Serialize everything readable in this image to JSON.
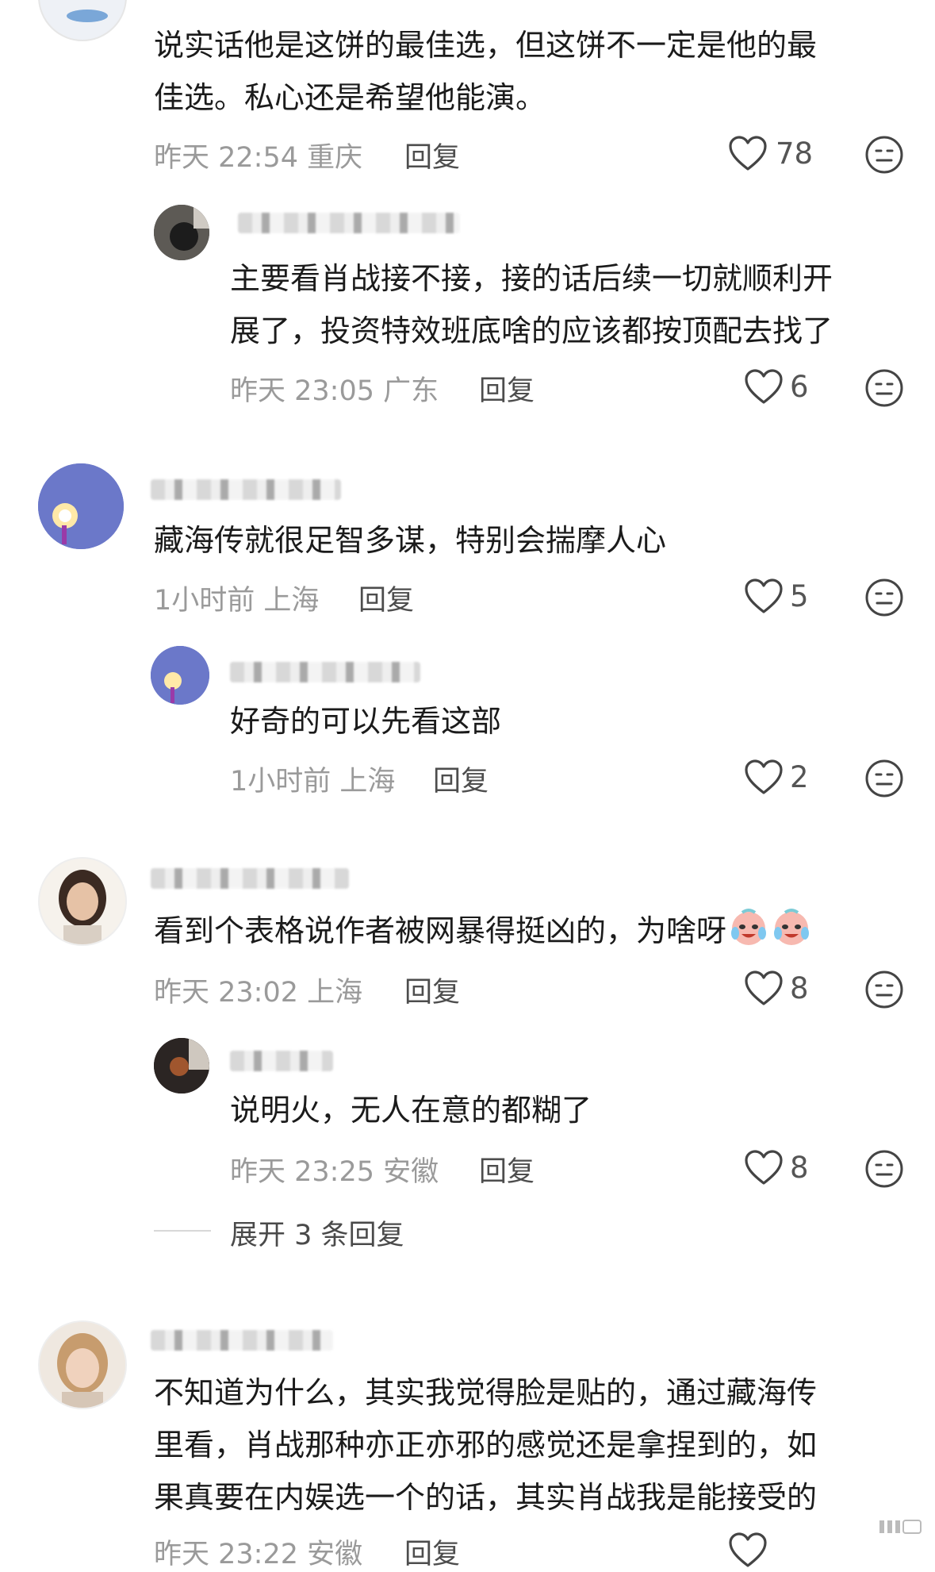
{
  "comments": [
    {
      "lines": [
        "说实话他是这饼的最佳选，但这饼不一定是他的最",
        "佳选。私心还是希望他能演。"
      ],
      "time": "昨天 22:54 重庆",
      "reply": "回复",
      "likes": "78"
    },
    {
      "lines": [
        "主要看肖战接不接，接的话后续一切就顺利开",
        "展了，投资特效班底啥的应该都按顶配去找了"
      ],
      "time": "昨天 23:05 广东",
      "reply": "回复",
      "likes": "6"
    },
    {
      "lines": [
        "藏海传就很足智多谋，特别会揣摩人心"
      ],
      "time": "1小时前 上海",
      "reply": "回复",
      "likes": "5"
    },
    {
      "lines": [
        "好奇的可以先看这部"
      ],
      "time": "1小时前 上海",
      "reply": "回复",
      "likes": "2"
    },
    {
      "lines": [
        "看到个表格说作者被网暴得挺凶的，为啥呀"
      ],
      "time": "昨天 23:02 上海",
      "reply": "回复",
      "likes": "8"
    },
    {
      "lines": [
        "说明火，无人在意的都糊了"
      ],
      "time": "昨天 23:25 安徽",
      "reply": "回复",
      "likes": "8"
    },
    {
      "lines": [
        "不知道为什么，其实我觉得脸是贴的，通过藏海传",
        "里看，肖战那种亦正亦邪的感觉还是拿捏到的，如",
        "果真要在内娱选一个的话，其实肖战我是能接受的"
      ],
      "time": "昨天 23:22 安徽",
      "reply": "回复",
      "likes": ""
    }
  ],
  "expand": {
    "label": "展开 3 条回复"
  },
  "icons": {
    "like": "heart-outline-icon",
    "dislike": "meh-face-icon",
    "emoji": "crying-laughing-emoji"
  },
  "colors": {
    "text": "#1b1b1b",
    "meta": "#9a9a9a",
    "icon": "#444444"
  }
}
